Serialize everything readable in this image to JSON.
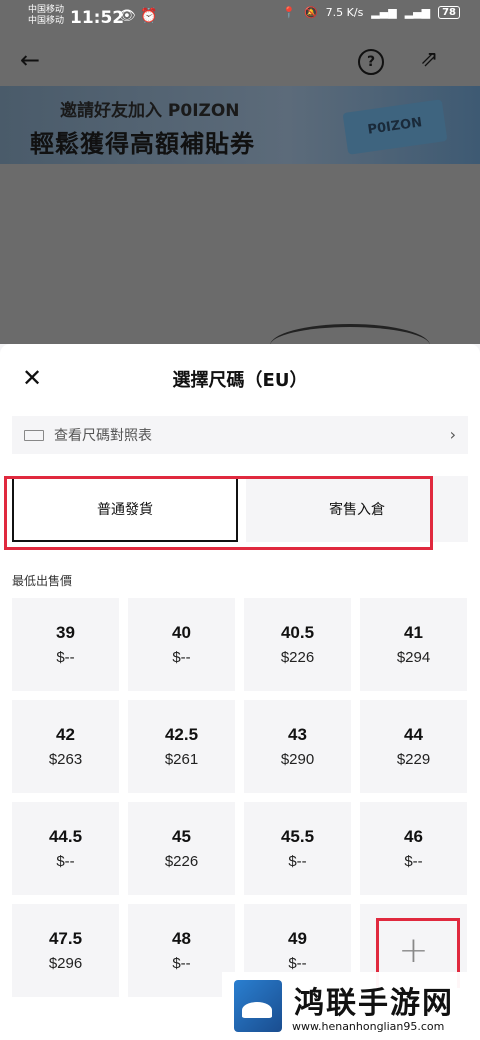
{
  "status_bar": {
    "carrier1": "中国移动",
    "carrier2": "中国移动",
    "time": "11:52",
    "net_speed": "7.5 K/s",
    "battery": "78"
  },
  "banner": {
    "line1": "邀請好友加入 P0IZON",
    "line2": "輕鬆獲得高額補貼券",
    "card_text": "P0IZON"
  },
  "sheet": {
    "title": "選擇尺碼（EU）",
    "size_chart_label": "查看尺碼對照表",
    "modes": [
      "普通發貨",
      "寄售入倉"
    ],
    "section_label": "最低出售價",
    "sizes": [
      {
        "size": "39",
        "price": "$--"
      },
      {
        "size": "40",
        "price": "$--"
      },
      {
        "size": "40.5",
        "price": "$226"
      },
      {
        "size": "41",
        "price": "$294"
      },
      {
        "size": "42",
        "price": "$263"
      },
      {
        "size": "42.5",
        "price": "$261"
      },
      {
        "size": "43",
        "price": "$290"
      },
      {
        "size": "44",
        "price": "$229"
      },
      {
        "size": "44.5",
        "price": "$--"
      },
      {
        "size": "45",
        "price": "$226"
      },
      {
        "size": "45.5",
        "price": "$--"
      },
      {
        "size": "46",
        "price": "$--"
      },
      {
        "size": "47.5",
        "price": "$296"
      },
      {
        "size": "48",
        "price": "$--"
      },
      {
        "size": "49",
        "price": "$--"
      }
    ],
    "add_symbol": "+"
  },
  "watermark": {
    "title": "鸿联手游网",
    "url": "www.henanhonglian95.com"
  },
  "colors": {
    "highlight": "#e0293e",
    "overlay": "#6b6b6b"
  }
}
